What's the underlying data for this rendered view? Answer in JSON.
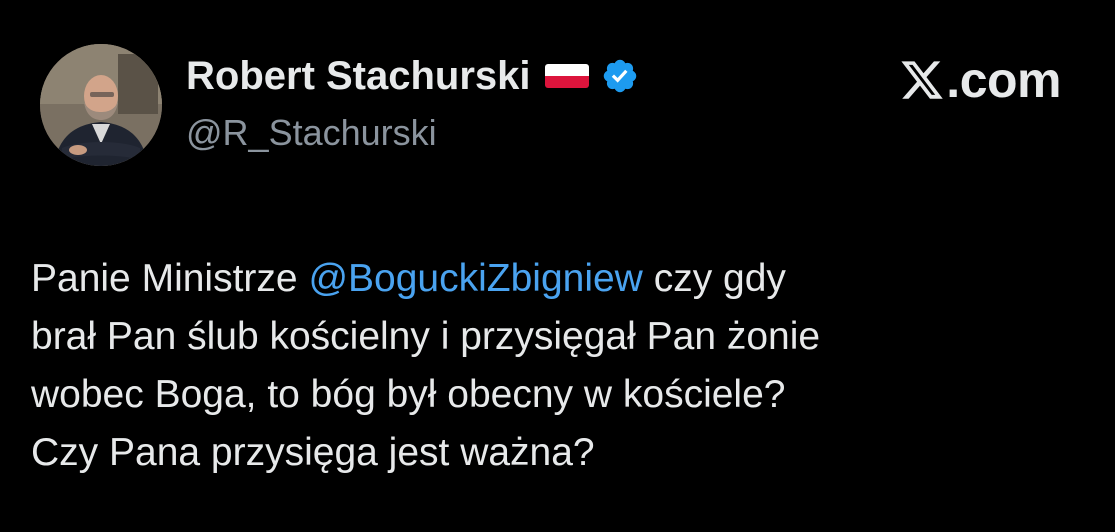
{
  "author": {
    "display_name": "Robert Stachurski",
    "handle": "@R_Stachurski",
    "flag_icon": "poland-flag-icon",
    "verified_icon": "verified-badge-icon",
    "verified_color": "#1d9bf0"
  },
  "site": {
    "logo_icon": "x-logo-icon",
    "label": ".com"
  },
  "tweet": {
    "line1_prefix": "Panie Ministrze ",
    "mention": "@BoguckiZbigniew",
    "line1_suffix": " czy gdy",
    "line2": "brał Pan ślub kościelny i przysięgał Pan żonie",
    "line3": "wobec Boga, to bóg był obecny w kościele?",
    "line4": "Czy Pana przysięga jest ważna?"
  },
  "colors": {
    "background": "#000000",
    "text": "#e7e9ea",
    "secondary_text": "#8b949e",
    "mention": "#4aa3f0"
  }
}
